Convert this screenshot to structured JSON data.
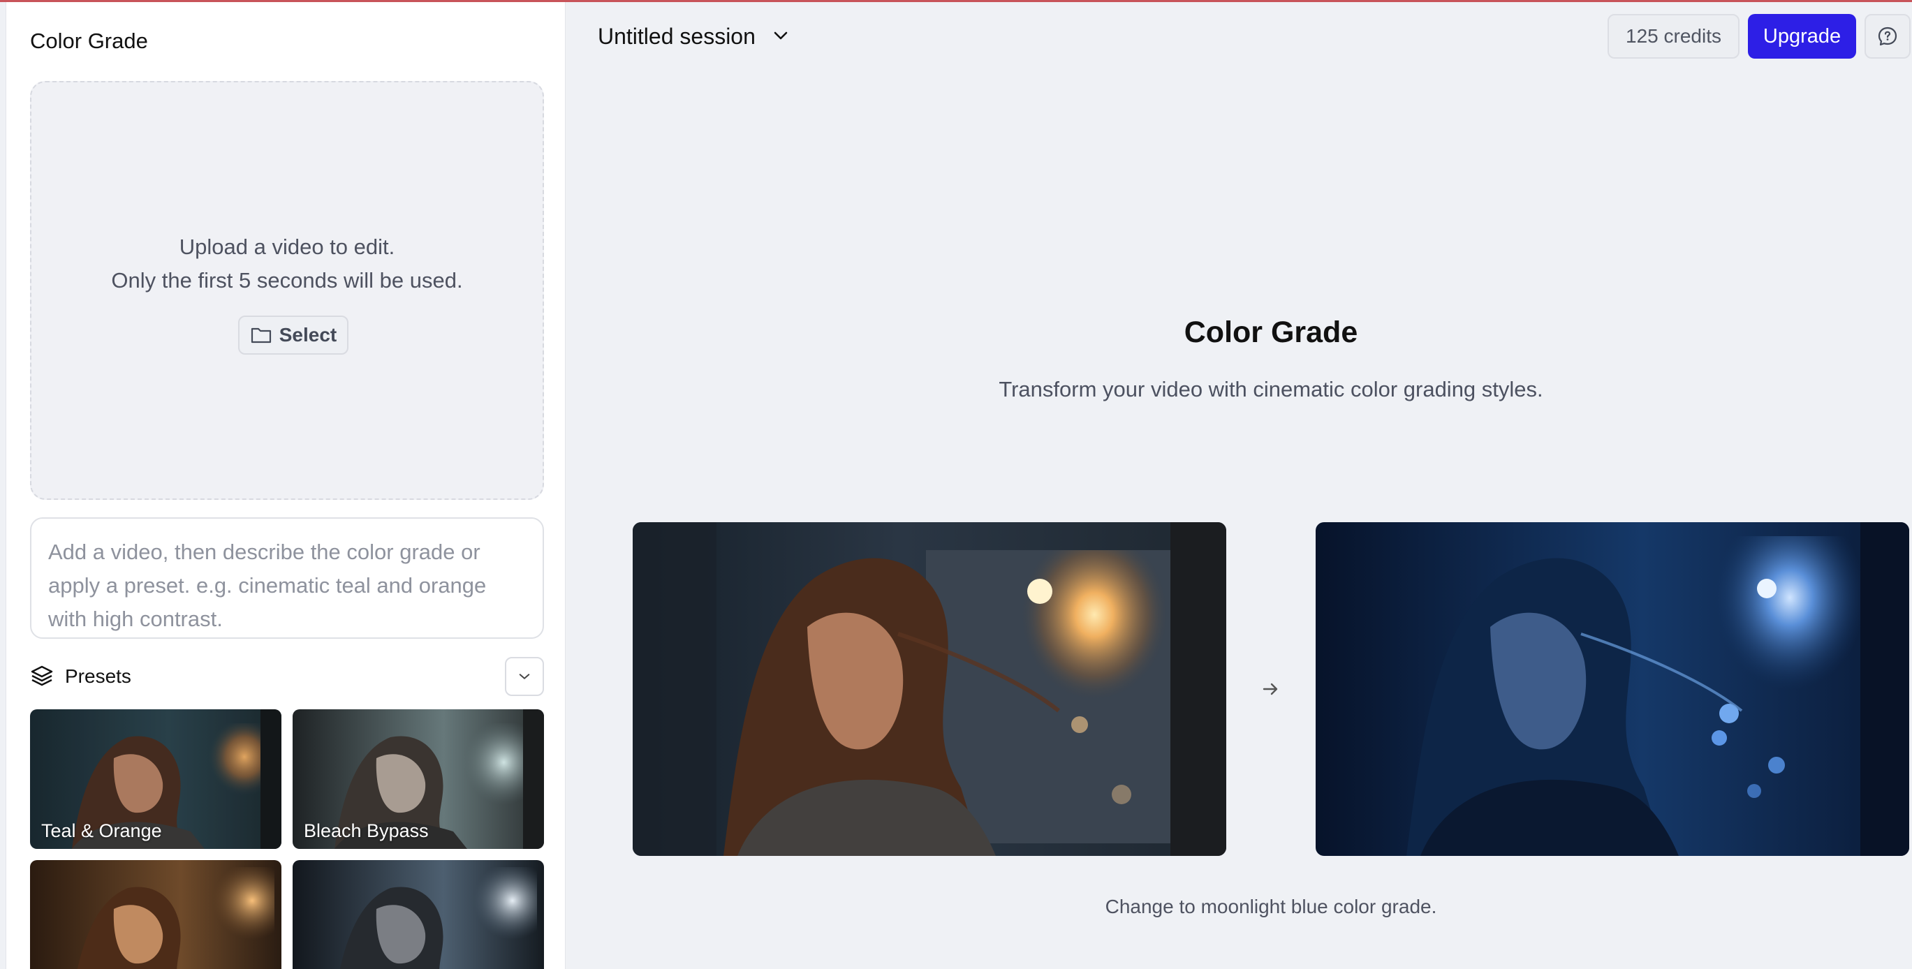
{
  "sidebar": {
    "title": "Color Grade",
    "upload": {
      "line1": "Upload a video to edit.",
      "line2": "Only the first 5 seconds will be used.",
      "select_label": "Select"
    },
    "prompt_placeholder": "Add a video, then describe the color grade or apply a preset. e.g. cinematic teal and orange with high contrast.",
    "presets": {
      "label": "Presets",
      "items": [
        {
          "label": "Teal & Orange"
        },
        {
          "label": "Bleach Bypass"
        },
        {
          "label": ""
        },
        {
          "label": ""
        }
      ]
    }
  },
  "header": {
    "session_title": "Untitled session",
    "credits": "125 credits",
    "upgrade_label": "Upgrade"
  },
  "main": {
    "title": "Color Grade",
    "subtitle": "Transform your video with cinematic color grading styles.",
    "example_caption": "Change to moonlight blue color grade."
  },
  "colors": {
    "accent": "#2d1fe6",
    "background": "#eff1f5",
    "sidebar_bg": "#ffffff",
    "top_border": "#c8545a"
  },
  "icons": [
    "folder-icon",
    "layers-icon",
    "chevron-down-icon",
    "help-chat-icon",
    "arrow-right-icon"
  ]
}
